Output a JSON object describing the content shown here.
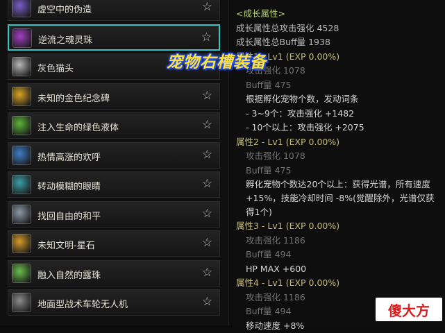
{
  "items": [
    {
      "name": "虚空中的伪造",
      "icon": "void-forge-icon",
      "color": "#7a5ec7",
      "selected": false
    },
    {
      "name": "逆流之魂灵珠",
      "icon": "soul-orb-icon",
      "color": "#a23fc2",
      "selected": true
    },
    {
      "name": "灰色猫头",
      "icon": "gray-cat-head-icon",
      "color": "#b8b8b8",
      "selected": false
    },
    {
      "name": "未知的金色纪念碑",
      "icon": "golden-monument-icon",
      "color": "#d8a424",
      "selected": false
    },
    {
      "name": "注入生命的绿色液体",
      "icon": "green-liquid-icon",
      "color": "#5eb43a",
      "selected": false
    },
    {
      "name": "热情高涨的欢呼",
      "icon": "cheer-icon",
      "color": "#3f7fc8",
      "selected": false
    },
    {
      "name": "转动模糊的眼睛",
      "icon": "blurry-eye-icon",
      "color": "#3aa0a8",
      "selected": false
    },
    {
      "name": "找回自由的和平",
      "icon": "freedom-peace-icon",
      "color": "#8a9aa8",
      "selected": false
    },
    {
      "name": "未知文明-星石",
      "icon": "star-stone-icon",
      "color": "#d59a2a",
      "selected": false
    },
    {
      "name": "融入自然的露珠",
      "icon": "dewdrop-icon",
      "color": "#6abf4b",
      "selected": false
    },
    {
      "name": "地面型战术车轮无人机",
      "icon": "wheel-drone-icon",
      "color": "#8c8c8c",
      "selected": false
    }
  ],
  "star_glyph": "☆",
  "overlay_title": "宠物右槽装备",
  "stats": {
    "title": "<成长属性>",
    "total_attack": "成长属性总攻击强化 4528",
    "total_buff": "成长属性总Buff量 1938",
    "properties": [
      {
        "header": "属性1 - Lv1 (EXP 0.00%)",
        "attack": "攻击强化 1078",
        "buff": "Buff量  475",
        "effects": [
          "根据孵化宠物个数，发动词条",
          "- 3~9个：攻击强化 +1482",
          "- 10个以上：攻击强化 +2075"
        ]
      },
      {
        "header": "属性2 - Lv1 (EXP 0.00%)",
        "attack": "攻击强化 1078",
        "buff": "Buff量  475",
        "effects": [
          "孵化宠物个数达20个以上：获得光谱，所有速度 +15%，技能冷却时间 -8%(觉醒除外，光谱仅获得1个)"
        ]
      },
      {
        "header": "属性3 - Lv1 (EXP 0.00%)",
        "attack": "攻击强化 1186",
        "buff": "Buff量  494",
        "effects": [
          "HP MAX +600"
        ]
      },
      {
        "header": "属性4 - Lv1 (EXP 0.00%)",
        "attack": "攻击强化 1186",
        "buff": "Buff量  494",
        "effects": [
          "移动速度 +8%"
        ]
      }
    ]
  },
  "watermark": "傻大方"
}
